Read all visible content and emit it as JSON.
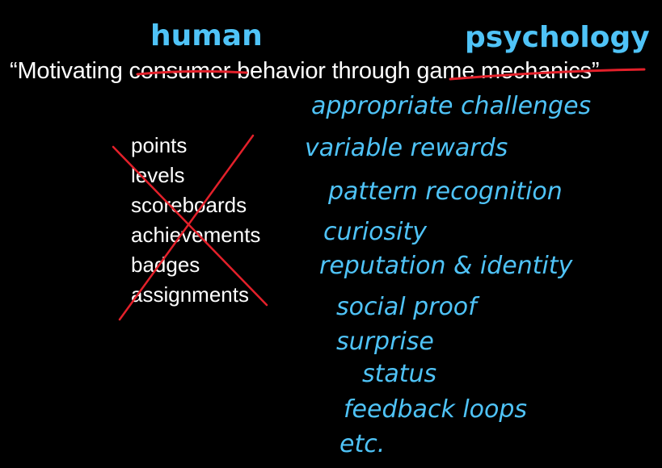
{
  "annotations": {
    "human": "human",
    "psychology": "psychology"
  },
  "quote": {
    "open": "“Motivating ",
    "struck_1": "consumer",
    "middle": " behavior through ",
    "struck_2": "game mechanics",
    "close": "”"
  },
  "game_mechanics": [
    "points",
    "levels",
    "scoreboards",
    "achievements",
    "badges",
    "assignments"
  ],
  "psychology_items": [
    "appropriate challenges",
    "variable rewards",
    "pattern recognition",
    "curiosity",
    "reputation & identity",
    "social proof",
    "surprise",
    "status",
    "feedback loops",
    "etc."
  ],
  "colors": {
    "background": "#000000",
    "text": "#ffffff",
    "handwriting": "#4fc3f7",
    "strike": "#e3202a"
  }
}
